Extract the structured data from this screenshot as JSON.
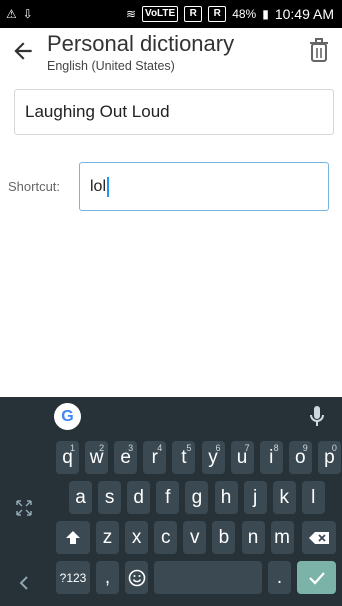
{
  "status_bar": {
    "battery": "48%",
    "time": "10:49 AM",
    "icons": {
      "alert": "warning-icon",
      "usb": "usb-icon",
      "wifi": "wifi-icon",
      "vo_lte": "VoLTE",
      "r1": "R",
      "r2": "R"
    }
  },
  "header": {
    "title": "Personal dictionary",
    "subtitle": "English (United States)"
  },
  "form": {
    "word_value": "Laughing Out Loud",
    "shortcut_label": "Shortcut:",
    "shortcut_value": "lol"
  },
  "keyboard": {
    "rows": [
      [
        "q",
        "w",
        "e",
        "r",
        "t",
        "y",
        "u",
        "i",
        "o",
        "p"
      ],
      [
        "a",
        "s",
        "d",
        "f",
        "g",
        "h",
        "j",
        "k",
        "l"
      ],
      [
        "z",
        "x",
        "c",
        "v",
        "b",
        "n",
        "m"
      ]
    ],
    "hints": [
      "1",
      "2",
      "3",
      "4",
      "5",
      "6",
      "7",
      "8",
      "9",
      "0"
    ],
    "bottom": {
      "symbols": "?123",
      "comma": ",",
      "period": "."
    }
  },
  "colors": {
    "keyboard_bg": "#263238",
    "key_bg": "#3b4a52",
    "enter_bg": "#7bb3a8",
    "focus_border": "#76b5e0"
  }
}
